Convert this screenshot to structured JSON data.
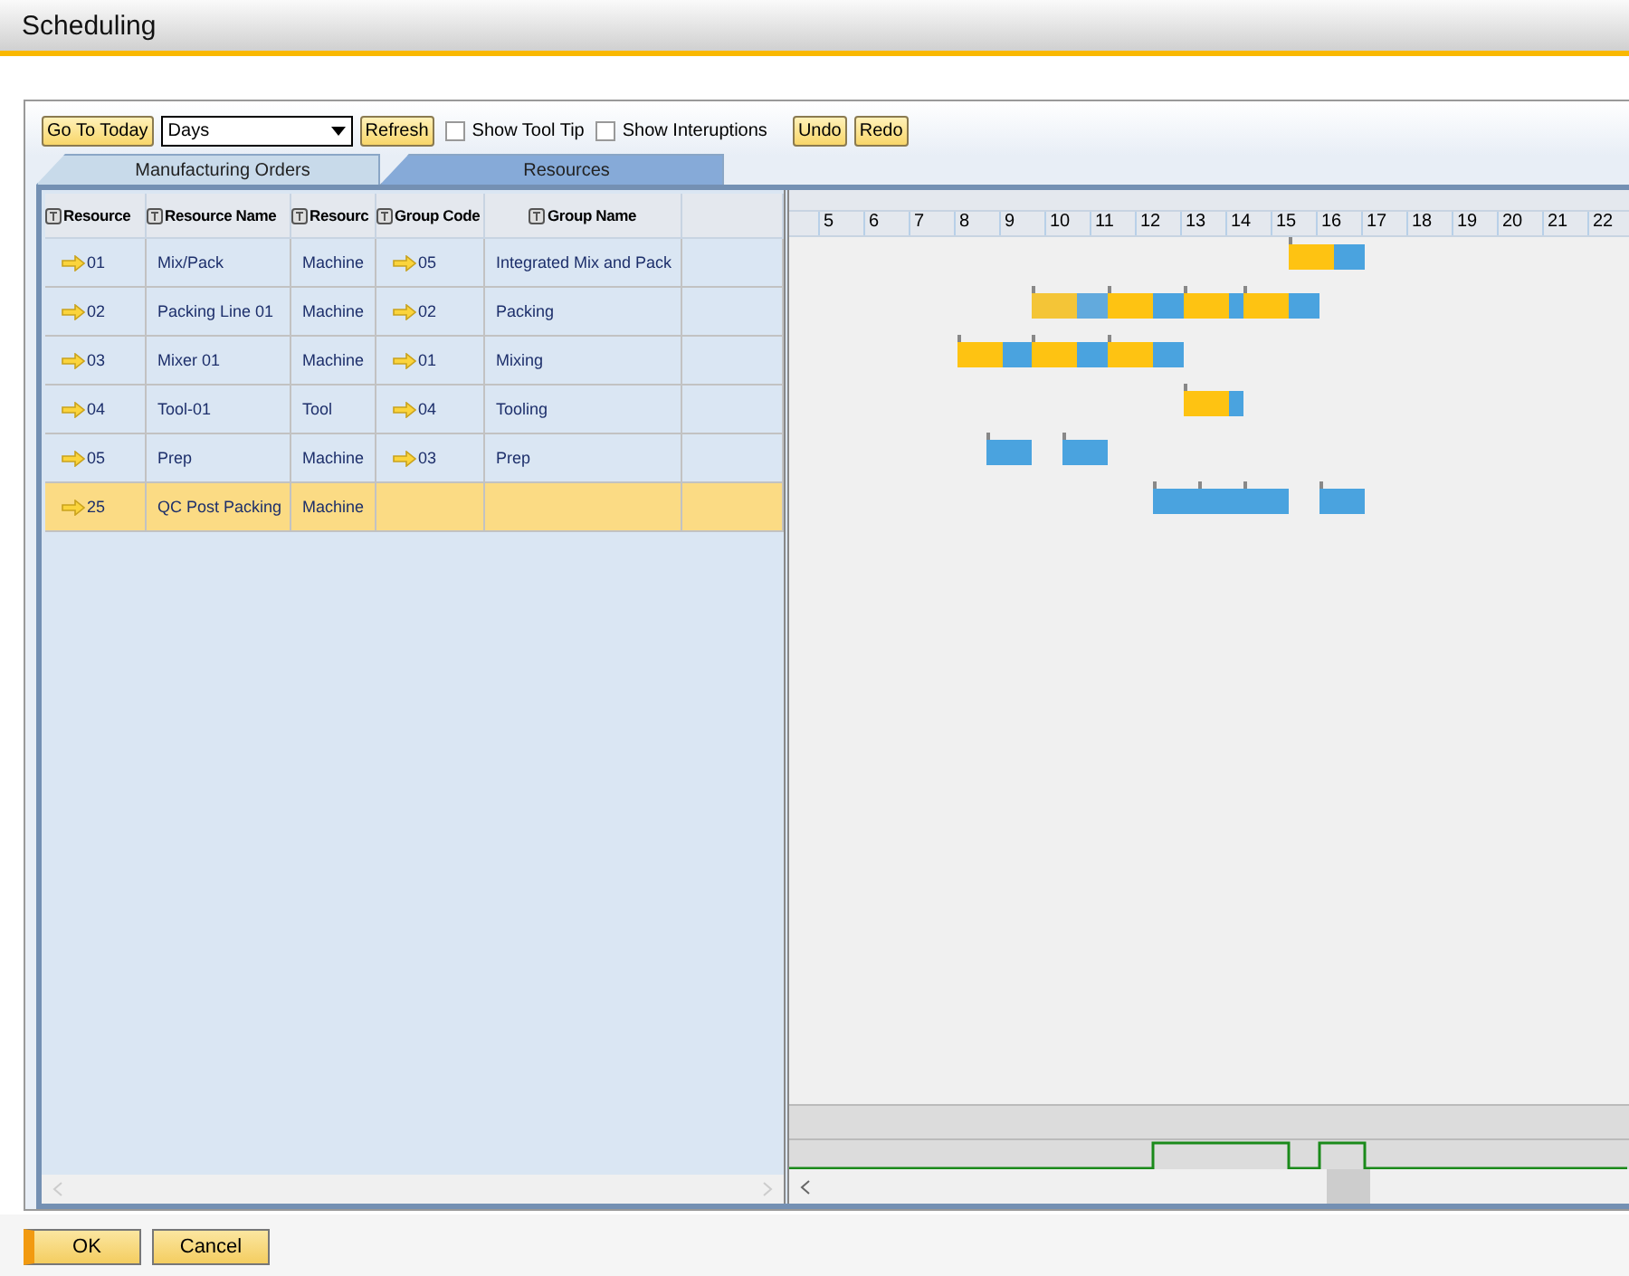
{
  "window": {
    "title": "Scheduling"
  },
  "toolbar": {
    "go_to_today": "Go To Today",
    "view": {
      "value": "Days"
    },
    "refresh": "Refresh",
    "options": [
      {
        "label": "Show Tool Tip",
        "checked": false
      },
      {
        "label": "Show Interuptions",
        "checked": false
      }
    ],
    "undo": "Undo",
    "redo": "Redo"
  },
  "tabs": [
    {
      "label": "Manufacturing Orders",
      "selected": false
    },
    {
      "label": "Resources",
      "selected": true
    }
  ],
  "table": {
    "columns": [
      "Resource",
      "Resource Name",
      "Resourc",
      "Group Code",
      "Group Name"
    ],
    "rows": [
      {
        "resource": "01",
        "name": "Mix/Pack",
        "type": "Machine",
        "group_code": "05",
        "group_name": "Integrated Mix and Pack",
        "selected": false
      },
      {
        "resource": "02",
        "name": "Packing Line 01",
        "type": "Machine",
        "group_code": "02",
        "group_name": "Packing",
        "selected": false
      },
      {
        "resource": "03",
        "name": "Mixer 01",
        "type": "Machine",
        "group_code": "01",
        "group_name": "Mixing",
        "selected": false
      },
      {
        "resource": "04",
        "name": "Tool-01",
        "type": "Tool",
        "group_code": "04",
        "group_name": "Tooling",
        "selected": false
      },
      {
        "resource": "05",
        "name": "Prep",
        "type": "Machine",
        "group_code": "03",
        "group_name": "Prep",
        "selected": false
      },
      {
        "resource": "25",
        "name": "QC Post Packing",
        "type": "Machine",
        "selected": true
      }
    ]
  },
  "gantt": {
    "days": [
      "5",
      "6",
      "7",
      "8",
      "9",
      "10",
      "11",
      "12",
      "13",
      "14",
      "15",
      "16",
      "17",
      "18",
      "19",
      "20",
      "21",
      "22"
    ]
  },
  "buttons": [
    {
      "label": "OK",
      "kind": "primary"
    },
    {
      "label": "Cancel",
      "kind": "secondary"
    }
  ]
}
